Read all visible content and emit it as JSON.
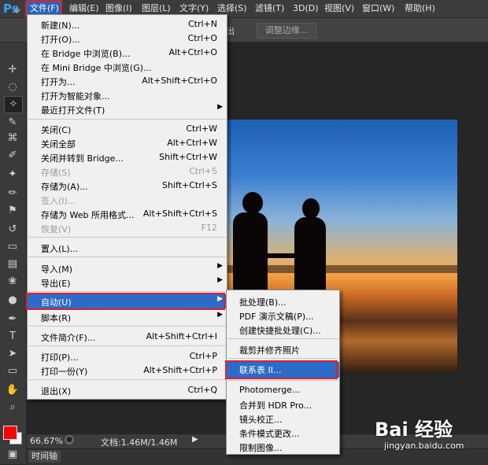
{
  "app": {
    "logo": "Ps"
  },
  "menubar": {
    "items": [
      {
        "label": "文件(F)"
      },
      {
        "label": "编辑(E)"
      },
      {
        "label": "图像(I)"
      },
      {
        "label": "图层(L)"
      },
      {
        "label": "文字(Y)"
      },
      {
        "label": "选择(S)"
      },
      {
        "label": "滤镜(T)"
      },
      {
        "label": "3D(D)"
      },
      {
        "label": "视图(V)"
      },
      {
        "label": "窗口(W)"
      },
      {
        "label": "帮助(H)"
      }
    ]
  },
  "options": {
    "partial_text": "出",
    "refine_edge": "调整边缘..."
  },
  "file_menu": {
    "items": [
      {
        "label": "新建(N)...",
        "shortcut": "Ctrl+N"
      },
      {
        "label": "打开(O)...",
        "shortcut": "Ctrl+O"
      },
      {
        "label": "在 Bridge 中浏览(B)...",
        "shortcut": "Alt+Ctrl+O"
      },
      {
        "label": "在 Mini Bridge 中浏览(G)...",
        "shortcut": ""
      },
      {
        "label": "打开为...",
        "shortcut": "Alt+Shift+Ctrl+O"
      },
      {
        "label": "打开为智能对象...",
        "shortcut": ""
      },
      {
        "label": "最近打开文件(T)",
        "shortcut": ""
      },
      {
        "label": "关闭(C)",
        "shortcut": "Ctrl+W"
      },
      {
        "label": "关闭全部",
        "shortcut": "Alt+Ctrl+W"
      },
      {
        "label": "关闭并转到 Bridge...",
        "shortcut": "Shift+Ctrl+W"
      },
      {
        "label": "存储(S)",
        "shortcut": "Ctrl+S"
      },
      {
        "label": "存储为(A)...",
        "shortcut": "Shift+Ctrl+S"
      },
      {
        "label": "签入(I)...",
        "shortcut": ""
      },
      {
        "label": "存储为 Web 所用格式...",
        "shortcut": "Alt+Shift+Ctrl+S"
      },
      {
        "label": "恢复(V)",
        "shortcut": "F12"
      },
      {
        "label": "置入(L)...",
        "shortcut": ""
      },
      {
        "label": "导入(M)",
        "shortcut": ""
      },
      {
        "label": "导出(E)",
        "shortcut": ""
      },
      {
        "label": "自动(U)",
        "shortcut": ""
      },
      {
        "label": "脚本(R)",
        "shortcut": ""
      },
      {
        "label": "文件简介(F)...",
        "shortcut": "Alt+Shift+Ctrl+I"
      },
      {
        "label": "打印(P)...",
        "shortcut": "Ctrl+P"
      },
      {
        "label": "打印一份(Y)",
        "shortcut": "Alt+Shift+Ctrl+P"
      },
      {
        "label": "退出(X)",
        "shortcut": "Ctrl+Q"
      }
    ]
  },
  "auto_submenu": {
    "items": [
      {
        "label": "批处理(B)..."
      },
      {
        "label": "PDF 演示文稿(P)..."
      },
      {
        "label": "创建快捷批处理(C)..."
      },
      {
        "label": "裁剪并修齐照片"
      },
      {
        "label": "联系表 II..."
      },
      {
        "label": "Photomerge..."
      },
      {
        "label": "合并到 HDR Pro..."
      },
      {
        "label": "镜头校正..."
      },
      {
        "label": "条件模式更改..."
      },
      {
        "label": "限制图像..."
      }
    ]
  },
  "status": {
    "zoom": "66.67%",
    "doc_size": "文档:1.46M/1.46M"
  },
  "timeline": {
    "label": "时间轴"
  },
  "colors": {
    "foreground": "#ff0000",
    "background": "#ffffff",
    "menu_highlight": "#2d6bc9"
  },
  "watermark": {
    "logo": "Bai 经验",
    "url": "jingyan.baidu.com"
  }
}
